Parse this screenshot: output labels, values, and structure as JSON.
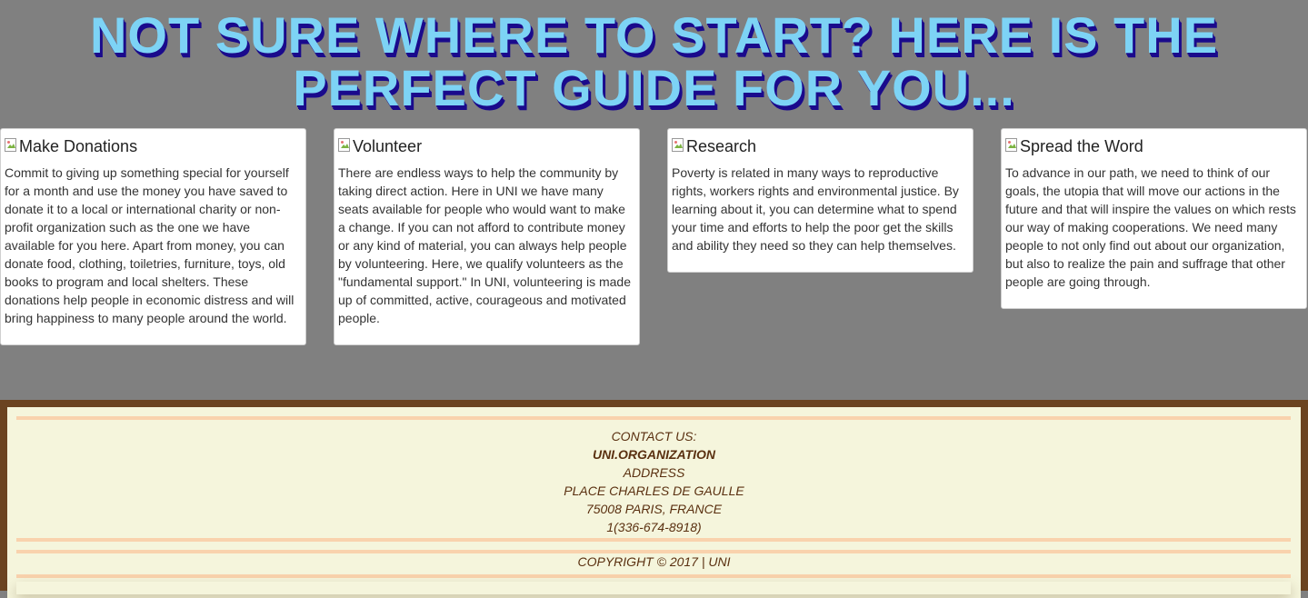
{
  "headline": "NOT SURE WHERE TO START? HERE IS THE PERFECT GUIDE FOR YOU...",
  "cards": [
    {
      "title": "Make Donations",
      "text": "Commit to giving up something special for yourself for a month and use the money you have saved to donate it to a local or international charity or non-profit organization such as the one we have available for you here. Apart from money, you can donate food, clothing, toiletries, furniture, toys, old books to program and local shelters. These donations help people in economic distress and will bring happiness to many people around the world."
    },
    {
      "title": "Volunteer",
      "text": "There are endless ways to help the community by taking direct action. Here in UNI we have many seats available for people who would want to make a change. If you can not afford to contribute money or any kind of material, you can always help people by volunteering. Here, we qualify volunteers as the \"fundamental support.\" In UNI, volunteering is made up of committed, active, courageous and motivated people."
    },
    {
      "title": "Research",
      "text": "Poverty is related in many ways to reproductive rights, workers rights and environmental justice. By learning about it, you can determine what to spend your time and efforts to help the poor get the skills and ability they need so they can help themselves."
    },
    {
      "title": "Spread the Word",
      "text": "To advance in our path, we need to think of our goals, the utopia that will move our actions in the future and that will inspire the values on which rests our way of making cooperations. We need many people to not only find out about our organization, but also to realize the pain and suffrage that other people are going through."
    }
  ],
  "footer": {
    "contact_label": "CONTACT US:",
    "org": "UNI.ORGANIZATION",
    "address_label": "ADDRESS",
    "street": "PLACE CHARLES DE GAULLE",
    "city": "75008 PARIS, FRANCE",
    "phone": "1(336-674-8918)",
    "copyright": "COPYRIGHT © 2017 | UNI"
  },
  "colors": {
    "page_bg": "#808080",
    "headline": "#7dd3f5",
    "headline_shadow": "#1a0a8c",
    "footer_border": "#6b4421",
    "footer_bg": "#f5f5dc",
    "footer_rule": "#f9d2ad",
    "footer_text": "#5a3010"
  },
  "icons": [
    "broken-image-icon"
  ]
}
